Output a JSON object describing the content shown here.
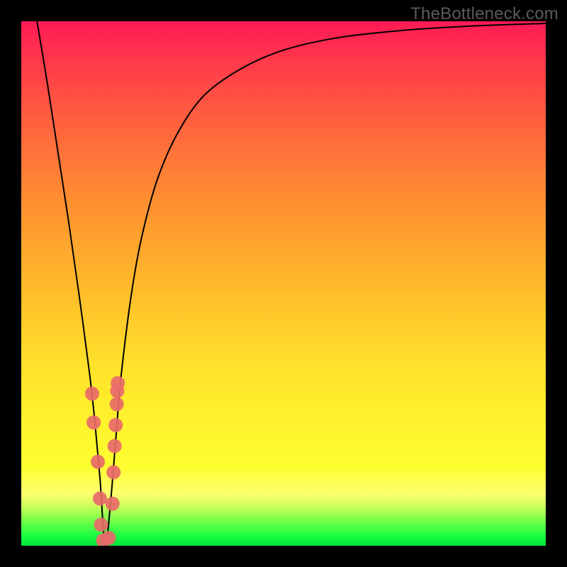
{
  "watermark": "TheBottleneck.com",
  "chart_data": {
    "type": "line",
    "title": "",
    "xlabel": "",
    "ylabel": "",
    "xlim": [
      0,
      100
    ],
    "ylim": [
      0,
      100
    ],
    "series": [
      {
        "name": "bottleneck-curve",
        "x": [
          3,
          5,
          7,
          9,
          11,
          13,
          14,
          15,
          16,
          17,
          18,
          19,
          21,
          23,
          26,
          30,
          35,
          42,
          50,
          60,
          72,
          86,
          100
        ],
        "values": [
          100,
          88,
          75,
          62,
          48,
          33,
          24,
          13,
          0,
          8,
          20,
          32,
          48,
          59,
          70,
          79,
          86,
          91,
          94.5,
          96.8,
          98.2,
          99.1,
          99.6
        ]
      },
      {
        "name": "scatter-markers",
        "x": [
          13.5,
          13.8,
          14.6,
          15.0,
          15.2,
          15.6,
          16.7,
          17.4,
          17.6,
          17.8,
          18.0,
          18.2,
          18.3,
          18.4
        ],
        "values": [
          29.0,
          23.5,
          16.0,
          9.0,
          4.0,
          1.0,
          1.5,
          8.0,
          14.0,
          19.0,
          23.0,
          27.0,
          29.5,
          31.0
        ]
      }
    ],
    "marker_color": "#e86a6a",
    "marker_radius_px": 10
  }
}
